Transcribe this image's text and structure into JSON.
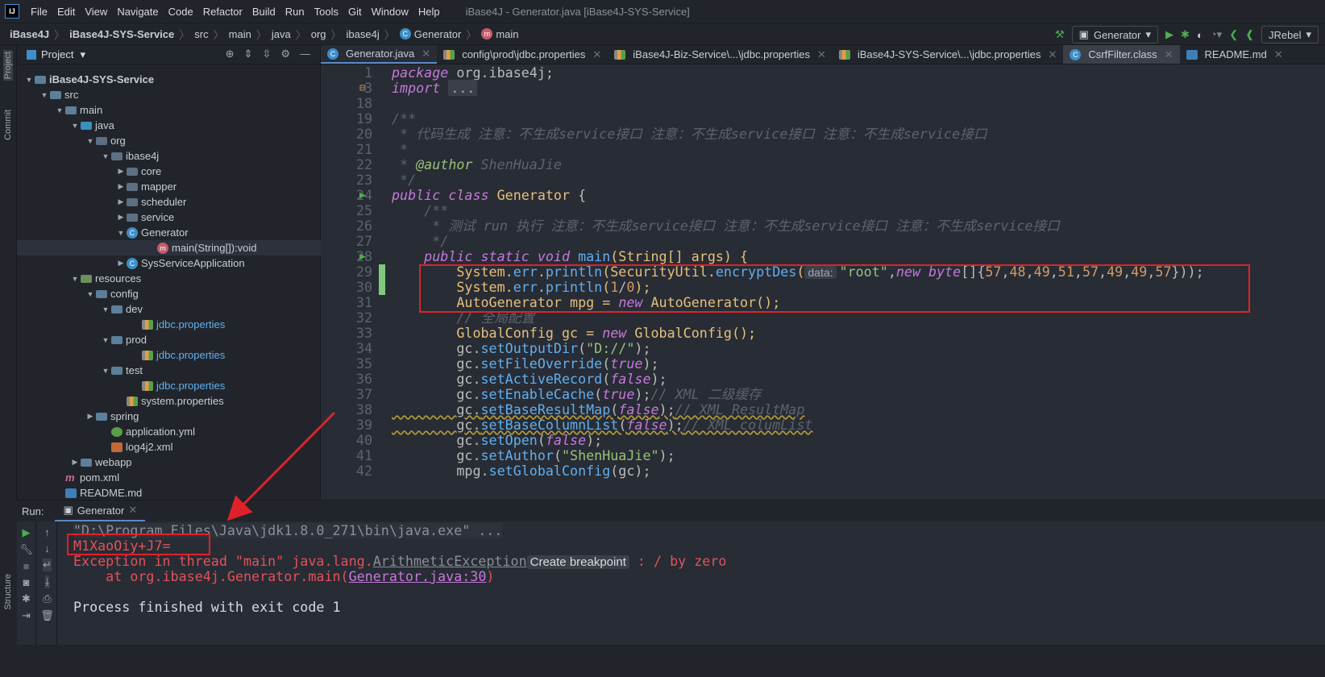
{
  "app": {
    "logo": "IJ",
    "window_title": "iBase4J - Generator.java [iBase4J-SYS-Service]"
  },
  "menu": [
    "File",
    "Edit",
    "View",
    "Navigate",
    "Code",
    "Refactor",
    "Build",
    "Run",
    "Tools",
    "Git",
    "Window",
    "Help"
  ],
  "breadcrumb": [
    "iBase4J",
    "iBase4J-SYS-Service",
    "src",
    "main",
    "java",
    "org",
    "ibase4j",
    "Generator",
    "main"
  ],
  "toolbar": {
    "run_config": "Generator",
    "jrebel": "JRebel",
    "icons": [
      "hammer-icon",
      "run-icon",
      "debug-icon",
      "coverage-icon",
      "profile-icon",
      "jrebel-run-icon",
      "jrebel-debug-icon"
    ]
  },
  "left_strip": {
    "project": "Project",
    "commit": "Commit",
    "structure": "Structure"
  },
  "project": {
    "title": "Project",
    "tree": [
      {
        "label": "iBase4J-SYS-Service",
        "level": 0,
        "arrow": "down",
        "icon": "folder",
        "bold": true
      },
      {
        "label": "src",
        "level": 1,
        "arrow": "down",
        "icon": "folder"
      },
      {
        "label": "main",
        "level": 2,
        "arrow": "down",
        "icon": "folder"
      },
      {
        "label": "java",
        "level": 3,
        "arrow": "down",
        "icon": "srcf"
      },
      {
        "label": "org",
        "level": 4,
        "arrow": "down",
        "icon": "pkg"
      },
      {
        "label": "ibase4j",
        "level": 5,
        "arrow": "down",
        "icon": "pkg"
      },
      {
        "label": "core",
        "level": 6,
        "arrow": "right",
        "icon": "pkg"
      },
      {
        "label": "mapper",
        "level": 6,
        "arrow": "right",
        "icon": "pkg"
      },
      {
        "label": "scheduler",
        "level": 6,
        "arrow": "right",
        "icon": "pkg"
      },
      {
        "label": "service",
        "level": 6,
        "arrow": "right",
        "icon": "pkg"
      },
      {
        "label": "Generator",
        "level": 6,
        "arrow": "down",
        "icon": "class"
      },
      {
        "label": "main(String[]):void",
        "level": 8,
        "arrow": "",
        "icon": "method",
        "selected": true
      },
      {
        "label": "SysServiceApplication",
        "level": 6,
        "arrow": "right",
        "icon": "class"
      },
      {
        "label": "resources",
        "level": 3,
        "arrow": "down",
        "icon": "resf"
      },
      {
        "label": "config",
        "level": 4,
        "arrow": "down",
        "icon": "folder"
      },
      {
        "label": "dev",
        "level": 5,
        "arrow": "down",
        "icon": "folder"
      },
      {
        "label": "jdbc.properties",
        "level": 7,
        "arrow": "",
        "icon": "prop",
        "link": true
      },
      {
        "label": "prod",
        "level": 5,
        "arrow": "down",
        "icon": "folder"
      },
      {
        "label": "jdbc.properties",
        "level": 7,
        "arrow": "",
        "icon": "prop",
        "link": true
      },
      {
        "label": "test",
        "level": 5,
        "arrow": "down",
        "icon": "folder"
      },
      {
        "label": "jdbc.properties",
        "level": 7,
        "arrow": "",
        "icon": "prop",
        "link": true
      },
      {
        "label": "system.properties",
        "level": 6,
        "arrow": "",
        "icon": "prop"
      },
      {
        "label": "spring",
        "level": 4,
        "arrow": "right",
        "icon": "folder"
      },
      {
        "label": "application.yml",
        "level": 5,
        "arrow": "",
        "icon": "yml"
      },
      {
        "label": "log4j2.xml",
        "level": 5,
        "arrow": "",
        "icon": "xml"
      },
      {
        "label": "webapp",
        "level": 3,
        "arrow": "right",
        "icon": "folder"
      },
      {
        "label": "pom.xml",
        "level": 2,
        "arrow": "",
        "icon": "pom"
      },
      {
        "label": "README.md",
        "level": 2,
        "arrow": "",
        "icon": "md"
      }
    ]
  },
  "tabs": [
    {
      "label": "Generator.java",
      "icon": "class",
      "state": "active"
    },
    {
      "label": "config\\prod\\jdbc.properties",
      "icon": "prop"
    },
    {
      "label": "iBase4J-Biz-Service\\...\\jdbc.properties",
      "icon": "prop"
    },
    {
      "label": "iBase4J-SYS-Service\\...\\jdbc.properties",
      "icon": "prop"
    },
    {
      "label": "CsrfFilter.class",
      "icon": "class",
      "state": "hl"
    },
    {
      "label": "README.md",
      "icon": "md"
    }
  ],
  "code": [
    {
      "n": "1",
      "t": [
        [
          "package",
          "k"
        ],
        [
          " org.ibase4j;",
          "p"
        ]
      ]
    },
    {
      "n": "3",
      "fold": true,
      "t": [
        [
          "import",
          "k"
        ],
        [
          " ",
          "p"
        ],
        [
          "...",
          "fold"
        ]
      ]
    },
    {
      "n": "18",
      "t": []
    },
    {
      "n": "19",
      "t": [
        [
          "/**",
          "c"
        ]
      ]
    },
    {
      "n": "20",
      "t": [
        [
          " * 代码生成 注意：不生成service接口 注意：不生成service接口 注意：不生成service接口",
          "c"
        ]
      ]
    },
    {
      "n": "21",
      "t": [
        [
          " *",
          "c"
        ]
      ]
    },
    {
      "n": "22",
      "t": [
        [
          " * ",
          "c"
        ],
        [
          "@author",
          "a"
        ],
        [
          " ShenHuaJie",
          "c"
        ]
      ]
    },
    {
      "n": "23",
      "t": [
        [
          " */",
          "c"
        ]
      ]
    },
    {
      "n": "24",
      "run": true,
      "t": [
        [
          "public class",
          "k"
        ],
        [
          " Generator ",
          "t"
        ],
        [
          "{",
          "p"
        ]
      ]
    },
    {
      "n": "25",
      "t": [
        [
          "    /**",
          "c"
        ]
      ]
    },
    {
      "n": "26",
      "t": [
        [
          "     * 测试 run 执行 注意：不生成service接口 注意：不生成service接口 注意：不生成service接口",
          "c"
        ]
      ]
    },
    {
      "n": "27",
      "t": [
        [
          "     */",
          "c"
        ]
      ]
    },
    {
      "n": "28",
      "run": true,
      "t": [
        [
          "    public static void ",
          "k"
        ],
        [
          "main",
          "f"
        ],
        [
          "(String[] args) {",
          "t"
        ]
      ]
    },
    {
      "n": "29",
      "chg": true,
      "t": [
        [
          "        System.",
          "t"
        ],
        [
          "err",
          "f"
        ],
        [
          ".",
          "p"
        ],
        [
          "println",
          "f"
        ],
        [
          "(SecurityUtil.",
          "t"
        ],
        [
          "encryptDes",
          "f"
        ],
        [
          "(",
          "t"
        ],
        [
          "data:",
          "h"
        ],
        [
          "\"root\"",
          "s"
        ],
        [
          ",",
          "p"
        ],
        [
          "new byte",
          "k"
        ],
        [
          "[]{",
          "p"
        ],
        [
          "57",
          "n"
        ],
        [
          ",",
          "p"
        ],
        [
          "48",
          "n"
        ],
        [
          ",",
          "p"
        ],
        [
          "49",
          "n"
        ],
        [
          ",",
          "p"
        ],
        [
          "51",
          "n"
        ],
        [
          ",",
          "p"
        ],
        [
          "57",
          "n"
        ],
        [
          ",",
          "p"
        ],
        [
          "49",
          "n"
        ],
        [
          ",",
          "p"
        ],
        [
          "49",
          "n"
        ],
        [
          ",",
          "p"
        ],
        [
          "57",
          "n"
        ],
        [
          "}));",
          "p"
        ]
      ]
    },
    {
      "n": "30",
      "chg": true,
      "t": [
        [
          "        System.",
          "t"
        ],
        [
          "err",
          "f"
        ],
        [
          ".",
          "p"
        ],
        [
          "println",
          "f"
        ],
        [
          "(",
          "t"
        ],
        [
          "1",
          "n"
        ],
        [
          "/",
          "p"
        ],
        [
          "0",
          "n"
        ],
        [
          ");",
          "t"
        ]
      ]
    },
    {
      "n": "31",
      "t": [
        [
          "        AutoGenerator mpg = ",
          "t"
        ],
        [
          "new",
          "k"
        ],
        [
          " AutoGenerator();",
          "t"
        ]
      ]
    },
    {
      "n": "32",
      "t": [
        [
          "        // 全局配置",
          "c"
        ]
      ]
    },
    {
      "n": "33",
      "t": [
        [
          "        GlobalConfig gc = ",
          "t"
        ],
        [
          "new",
          "k"
        ],
        [
          " GlobalConfig();",
          "t"
        ]
      ]
    },
    {
      "n": "34",
      "t": [
        [
          "        gc.",
          "p"
        ],
        [
          "setOutputDir",
          "f"
        ],
        [
          "(",
          "p"
        ],
        [
          "\"D://\"",
          "s"
        ],
        [
          ");",
          "p"
        ]
      ]
    },
    {
      "n": "35",
      "t": [
        [
          "        gc.",
          "p"
        ],
        [
          "setFileOverride",
          "f"
        ],
        [
          "(",
          "p"
        ],
        [
          "true",
          "k"
        ],
        [
          ");",
          "p"
        ]
      ]
    },
    {
      "n": "36",
      "t": [
        [
          "        gc.",
          "p"
        ],
        [
          "setActiveRecord",
          "f"
        ],
        [
          "(",
          "p"
        ],
        [
          "false",
          "k"
        ],
        [
          ");",
          "p"
        ]
      ]
    },
    {
      "n": "37",
      "t": [
        [
          "        gc.",
          "p"
        ],
        [
          "setEnableCache",
          "f"
        ],
        [
          "(",
          "p"
        ],
        [
          "true",
          "k"
        ],
        [
          ");",
          "p"
        ],
        [
          "// XML 二级缓存",
          "c"
        ]
      ]
    },
    {
      "n": "38",
      "warn": true,
      "t": [
        [
          "        gc.",
          "p"
        ],
        [
          "setBaseResultMap",
          "f"
        ],
        [
          "(",
          "p"
        ],
        [
          "false",
          "k"
        ],
        [
          ");",
          "p"
        ],
        [
          "// XML ResultMap",
          "c"
        ]
      ]
    },
    {
      "n": "39",
      "warn": true,
      "t": [
        [
          "        gc.",
          "p"
        ],
        [
          "setBaseColumnList",
          "f"
        ],
        [
          "(",
          "p"
        ],
        [
          "false",
          "k"
        ],
        [
          ");",
          "p"
        ],
        [
          "// XML columList",
          "c"
        ]
      ]
    },
    {
      "n": "40",
      "t": [
        [
          "        gc.",
          "p"
        ],
        [
          "setOpen",
          "f"
        ],
        [
          "(",
          "p"
        ],
        [
          "false",
          "k"
        ],
        [
          ");",
          "p"
        ]
      ]
    },
    {
      "n": "41",
      "t": [
        [
          "        gc.",
          "p"
        ],
        [
          "setAuthor",
          "f"
        ],
        [
          "(",
          "p"
        ],
        [
          "\"ShenHuaJie\"",
          "s"
        ],
        [
          ");",
          "p"
        ]
      ]
    },
    {
      "n": "42",
      "t": [
        [
          "        mpg.",
          "p"
        ],
        [
          "setGlobalConfig",
          "f"
        ],
        [
          "(gc);",
          "p"
        ]
      ]
    }
  ],
  "run": {
    "label": "Run:",
    "tab": "Generator",
    "cmd": "\"D:\\Program Files\\Java\\jdk1.8.0_271\\bin\\java.exe\" ...",
    "output": "M1XaoOiy+J7=",
    "exception_prefix": "Exception in thread \"main\" java.lang.",
    "exception_class": "ArithmeticException",
    "create_breakpoint": "Create breakpoint",
    "exception_suffix": " : / by zero",
    "at_prefix": "    at org.ibase4j.Generator.main(",
    "at_link": "Generator.java:30",
    "at_suffix": ")",
    "finished": "Process finished with exit code 1"
  },
  "colors": {
    "annotation": "#e0212a",
    "keyword": "#c678dd",
    "string": "#98c379",
    "error": "#e0535c"
  }
}
